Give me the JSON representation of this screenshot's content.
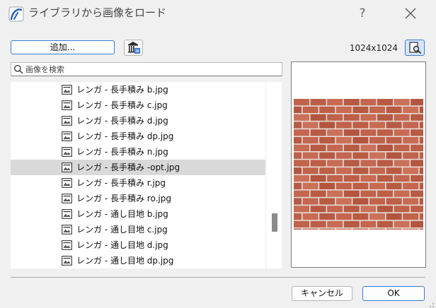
{
  "window": {
    "title": "ライブラリから画像をロード",
    "help_label": "?",
    "app_icon": "archicad-arc-icon",
    "close_icon": "close-icon"
  },
  "toolbar": {
    "add_label": "追加...",
    "library_icon": "library-manager-icon",
    "image_dimensions": "1024x1024",
    "preview_icon": "preview-magnifier-icon"
  },
  "search": {
    "placeholder": "画像を検索",
    "value": ""
  },
  "file_list": {
    "items": [
      {
        "label": "レンガ - 長手積み b.jpg",
        "selected": false
      },
      {
        "label": "レンガ - 長手積み c.jpg",
        "selected": false
      },
      {
        "label": "レンガ - 長手積み d.jpg",
        "selected": false
      },
      {
        "label": "レンガ - 長手積み dp.jpg",
        "selected": false
      },
      {
        "label": "レンガ - 長手積み n.jpg",
        "selected": false
      },
      {
        "label": "レンガ - 長手積み -opt.jpg",
        "selected": true
      },
      {
        "label": "レンガ - 長手積み r.jpg",
        "selected": false
      },
      {
        "label": "レンガ - 長手積み ro.jpg",
        "selected": false
      },
      {
        "label": "レンガ - 通し目地 b.jpg",
        "selected": false
      },
      {
        "label": "レンガ - 通し目地 c.jpg",
        "selected": false
      },
      {
        "label": "レンガ - 通し目地 d.jpg",
        "selected": false
      },
      {
        "label": "レンガ - 通し目地 dp.jpg",
        "selected": false
      }
    ]
  },
  "preview": {
    "image": "brick-texture-preview",
    "brick_color": "#c0634a",
    "mortar_color": "#e6dcd6"
  },
  "footer": {
    "cancel_label": "キャンセル",
    "ok_label": "OK"
  },
  "colors": {
    "accent": "#3a7bd5",
    "selection": "#d9d9d9",
    "background": "#f0f0f0"
  }
}
